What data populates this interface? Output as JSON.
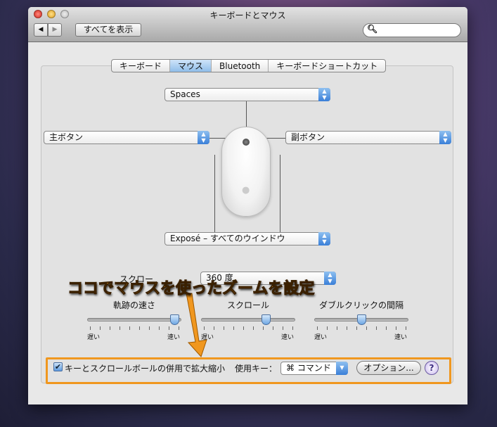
{
  "window": {
    "title": "キーボードとマウス"
  },
  "toolbar": {
    "back": "◀",
    "forward": "▶",
    "show_all": "すべてを表示",
    "search_placeholder": ""
  },
  "tabs": [
    {
      "label": "キーボード"
    },
    {
      "label": "マウス",
      "selected": true
    },
    {
      "label": "Bluetooth"
    },
    {
      "label": "キーボードショートカット"
    }
  ],
  "mouse": {
    "top": "Spaces",
    "left": "主ボタン",
    "right": "副ボタン",
    "bottom": "Exposé – すべてのウインドウ",
    "scroll_label": "スクロー",
    "scroll_value": "360 度"
  },
  "sliders": [
    {
      "label": "軌跡の速さ",
      "min": "遅い",
      "max": "速い",
      "value": 0.95
    },
    {
      "label": "スクロール",
      "min": "遅い",
      "max": "速い",
      "value": 0.7
    },
    {
      "label": "ダブルクリックの間隔",
      "min": "遅い",
      "max": "速い",
      "value": 0.5
    }
  ],
  "zoom": {
    "checkbox_label": "キーとスクロールボールの併用で拡大縮小",
    "checked": true,
    "key_label": "使用キー：",
    "key_value": "⌘ コマンド",
    "options": "オプション...",
    "help": "?"
  },
  "annotation": {
    "text": "ココでマウスを使ったズームを設定",
    "color": "#f0971f"
  }
}
